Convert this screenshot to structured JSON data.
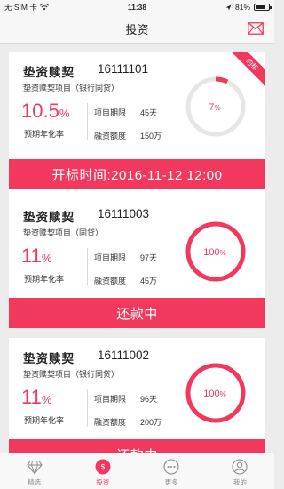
{
  "status_bar": {
    "carrier": "无 SIM 卡",
    "time": "11:38",
    "battery_percent": "81%",
    "battery_level": 0.81
  },
  "header": {
    "title": "投资",
    "mail_icon": "mail-icon"
  },
  "products": [
    {
      "name": "垫资赎契",
      "code": "16111101",
      "subtitle": "垫资赎契项目（银行同贷）",
      "rate_value": "10.5",
      "rate_unit": "%",
      "rate_label": "预期年化率",
      "term_label": "项目期限",
      "term_value": "45天",
      "amount_label": "融资额度",
      "amount_value": "150万",
      "progress_text": "7",
      "progress_unit": "%",
      "progress": 0.07,
      "ribbon": "约标",
      "action": "开标时间:2016-11-12 12:00"
    },
    {
      "name": "垫资赎契",
      "code": "16111003",
      "subtitle": "垫资赎契项目（同贷）",
      "rate_value": "11",
      "rate_unit": "%",
      "rate_label": "预期年化率",
      "term_label": "项目期限",
      "term_value": "97天",
      "amount_label": "融资额度",
      "amount_value": "45万",
      "progress_text": "100",
      "progress_unit": "%",
      "progress": 1.0,
      "action": "还款中"
    },
    {
      "name": "垫资赎契",
      "code": "16111002",
      "subtitle": "垫资赎契项目（银行同贷）",
      "rate_value": "11",
      "rate_unit": "%",
      "rate_label": "预期年化率",
      "term_label": "项目期限",
      "term_value": "96天",
      "amount_label": "融资额度",
      "amount_value": "200万",
      "progress_text": "100",
      "progress_unit": "%",
      "progress": 1.0,
      "action": "还款中"
    }
  ],
  "tabs": [
    {
      "label": "精选",
      "icon": "diamond-icon",
      "active": false
    },
    {
      "label": "投资",
      "icon": "coin-icon",
      "active": true
    },
    {
      "label": "更多",
      "icon": "more-icon",
      "active": false
    },
    {
      "label": "我的",
      "icon": "user-icon",
      "active": false
    }
  ],
  "colors": {
    "accent": "#f2385d",
    "ring_track": "#e6e6e6",
    "tab_inactive": "#8a8a8a"
  }
}
